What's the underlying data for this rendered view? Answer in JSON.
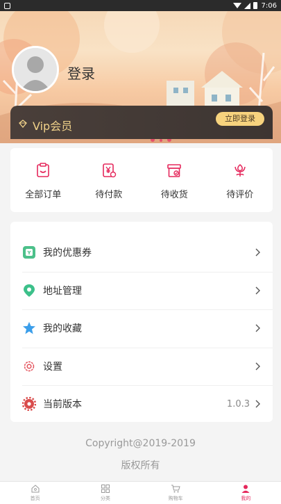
{
  "status_bar": {
    "time": "7:06"
  },
  "user": {
    "login_label": "登录"
  },
  "vip": {
    "label": "Vip会员",
    "button_label": "立即登录",
    "accent": "#f1d28a"
  },
  "orders": [
    {
      "label": "全部订单",
      "icon": "clipboard-icon"
    },
    {
      "label": "待付款",
      "icon": "yen-bill-icon"
    },
    {
      "label": "待收货",
      "icon": "package-check-icon"
    },
    {
      "label": "待评价",
      "icon": "flower-icon"
    }
  ],
  "menu": [
    {
      "label": "我的优惠券",
      "icon": "coupon-icon",
      "value": ""
    },
    {
      "label": "地址管理",
      "icon": "location-pin-icon",
      "value": ""
    },
    {
      "label": "我的收藏",
      "icon": "star-icon",
      "value": ""
    },
    {
      "label": "设置",
      "icon": "gear-outline-icon",
      "value": ""
    },
    {
      "label": "当前版本",
      "icon": "gear-filled-icon",
      "value": "1.0.3"
    }
  ],
  "footer": {
    "copyright": "Copyright@2019-2019",
    "rights": "版权所有"
  },
  "tabbar": [
    {
      "label": "首页",
      "icon": "home-icon",
      "active": false
    },
    {
      "label": "分类",
      "icon": "grid-icon",
      "active": false
    },
    {
      "label": "购物车",
      "icon": "cart-icon",
      "active": false
    },
    {
      "label": "我的",
      "icon": "person-icon",
      "active": true
    }
  ],
  "colors": {
    "primary": "#e5285c",
    "coupon": "#4cc08a",
    "address": "#3cc08a",
    "favorite": "#3b9eea",
    "settings": "#e3505a"
  }
}
